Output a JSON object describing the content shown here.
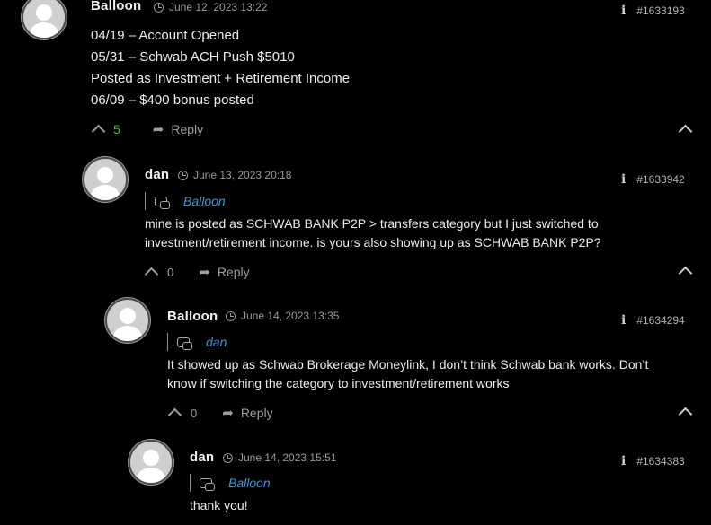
{
  "comments": [
    {
      "author": "Balloon",
      "date": "June 12, 2023 13:22",
      "id": "#1633193",
      "lines": [
        "04/19 – Account Opened",
        "05/31 – Schwab ACH Push $5010",
        "Posted as Investment + Retirement Income",
        "06/09 – $400 bonus posted"
      ],
      "votes": "5",
      "reply_label": "Reply"
    },
    {
      "author": "dan",
      "date": "June 13, 2023 20:18",
      "id": "#1633942",
      "reply_to": "Balloon",
      "lines": [
        "mine is posted as SCHWAB BANK P2P > transfers category but I just switched to",
        "investment/retirement income. is yours also showing up as SCHWAB BANK P2P?"
      ],
      "votes": "0",
      "reply_label": "Reply"
    },
    {
      "author": "Balloon",
      "date": "June 14, 2023 13:35",
      "id": "#1634294",
      "reply_to": "dan",
      "lines": [
        "It showed up as Schwab Brokerage Moneylink, I don’t think Schwab bank works. Don’t",
        "know if switching the category to investment/retirement works"
      ],
      "votes": "0",
      "reply_label": "Reply"
    },
    {
      "author": "dan",
      "date": "June 14, 2023 15:51",
      "id": "#1634383",
      "reply_to": "Balloon",
      "lines": [
        "thank you!"
      ]
    }
  ],
  "colors": {
    "background": "#000000",
    "link": "#4d8fd1",
    "positive_vote": "#4caf50"
  },
  "icons": [
    "clock-icon",
    "info-icon",
    "reply-bubble-icon",
    "upvote-icon",
    "reply-arrow-icon",
    "collapse-icon"
  ]
}
